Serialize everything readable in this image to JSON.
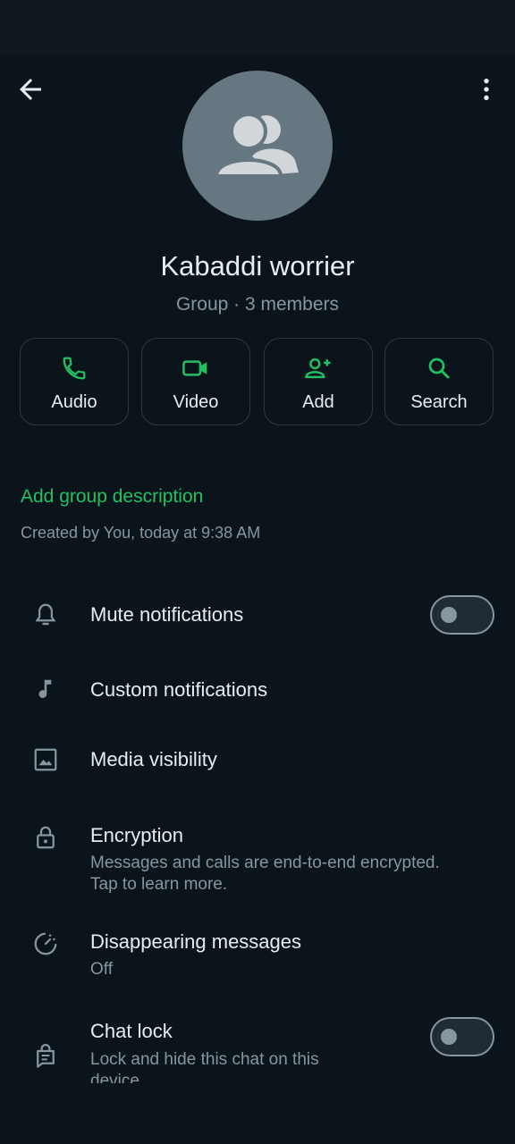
{
  "header": {
    "back_icon": "arrow-left-icon",
    "more_icon": "more-vert-icon"
  },
  "group": {
    "name": "Kabaddi worrier",
    "subtitle": "Group · 3 members",
    "avatar_icon": "group-icon"
  },
  "actions": [
    {
      "label": "Audio",
      "icon": "phone-icon"
    },
    {
      "label": "Video",
      "icon": "videocam-icon"
    },
    {
      "label": "Add",
      "icon": "person-add-icon"
    },
    {
      "label": "Search",
      "icon": "search-icon"
    }
  ],
  "description": {
    "link": "Add group description",
    "created": "Created by You, today at 9:38 AM"
  },
  "settings": {
    "mute": {
      "title": "Mute notifications",
      "enabled": false
    },
    "custom": {
      "title": "Custom notifications"
    },
    "media": {
      "title": "Media visibility"
    },
    "encryption": {
      "title": "Encryption",
      "subtitle_line1": "Messages and calls are end-to-end encrypted.",
      "subtitle_line2": "Tap to learn more."
    },
    "disappearing": {
      "title": "Disappearing messages",
      "subtitle": "Off"
    },
    "chat_lock": {
      "title": "Chat lock",
      "subtitle_line1": "Lock and hide this chat on this",
      "subtitle_line2": "device",
      "enabled": false
    }
  },
  "colors": {
    "background": "#0b141a",
    "accent": "#21c063",
    "text_primary": "#e9edef",
    "text_secondary": "#8696a0",
    "avatar_bg": "#667781"
  }
}
